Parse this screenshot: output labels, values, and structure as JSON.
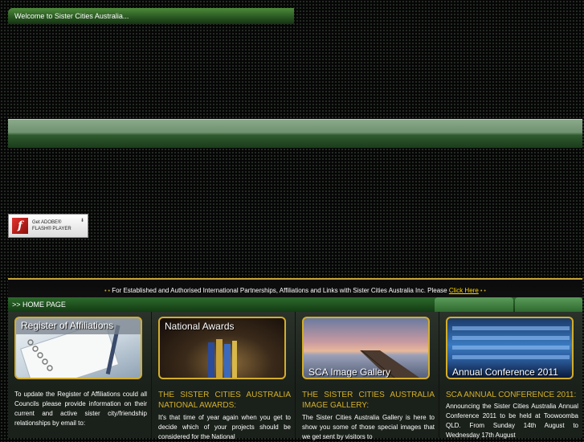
{
  "header": {
    "welcome": "Welcome to Sister Cities Australia..."
  },
  "flash": {
    "line1": "Get ADOBE®",
    "line2": "FLASH® PLAYER",
    "logo_letter": "f"
  },
  "notice": {
    "bullets_left": "• •",
    "text": "For Established and Authorised International Partnerships, Affiliations and Links with Sister Cities Australia Inc. Please",
    "link": "Click Here",
    "bullets_right": "• •"
  },
  "nav": {
    "label": ">> HOME PAGE"
  },
  "columns": [
    {
      "image_label": "Register of Affiliations",
      "title": "",
      "text": "To update the Register of Affiliations could all Councils please provide information on their current and active sister city/friendship relationships by email to:"
    },
    {
      "image_label": "National Awards",
      "title": "THE SISTER CITIES AUSTRALIA NATIONAL AWARDS:",
      "text": "It's that time of year again when you get to decide which of your projects should be considered for the National"
    },
    {
      "image_label": "SCA Image Gallery",
      "title": "THE SISTER CITIES AUSTRALIA IMAGE GALLERY:",
      "text": "The Sister Cities Australia Gallery is here to show you some of those special images that we get sent by visitors to"
    },
    {
      "image_label": "Annual Conference 2011",
      "title": "SCA ANNUAL CONFERENCE 2011:",
      "text": "Announcing the Sister Cities Australia Annual Conference 2011 to be held at Toowoomba QLD. From Sunday 14th August to Wednesday 17th August"
    }
  ],
  "colors": {
    "accent_gold": "#d4b02a",
    "green_bar": "#2c6a2c",
    "background": "#050605"
  }
}
